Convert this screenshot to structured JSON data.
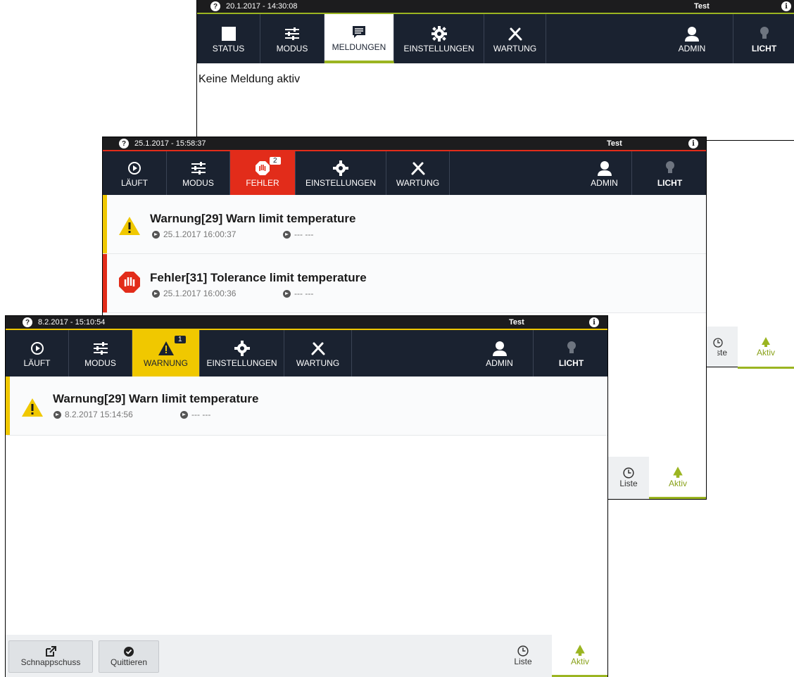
{
  "colors": {
    "nav_bg": "#1a2230",
    "accent_green": "#9bb521",
    "error_red": "#e22c1a",
    "warning_yellow": "#f0c800"
  },
  "panel1": {
    "datetime": "20.1.2017 - 14:30:08",
    "user": "Test",
    "tabs": {
      "status": "STATUS",
      "modus": "MODUS",
      "meldungen": "MELDUNGEN",
      "einstellungen": "EINSTELLUNGEN",
      "wartung": "WARTUNG",
      "admin": "ADMIN",
      "licht": "LICHT"
    },
    "message": "Keine Meldung aktiv"
  },
  "panel2": {
    "datetime": "25.1.2017 - 15:58:37",
    "user": "Test",
    "tabs": {
      "laeuft": "LÄUFT",
      "modus": "MODUS",
      "fehler": "FEHLER",
      "fehler_count": "2",
      "einstellungen": "EINSTELLUNGEN",
      "wartung": "WARTUNG",
      "admin": "ADMIN",
      "licht": "LICHT"
    },
    "messages": [
      {
        "title": "Warnung[29] Warn limit temperature",
        "start": "25.1.2017 16:00:37",
        "end": "--- ---",
        "icon": "warning-icon"
      },
      {
        "title": "Fehler[31] Tolerance limit temperature",
        "start": "25.1.2017 16:00:36",
        "end": "--- ---",
        "icon": "stop-hand-icon"
      }
    ],
    "footer": {
      "liste": "Liste",
      "aktiv": "Aktiv"
    }
  },
  "panel3": {
    "datetime": "8.2.2017 - 15:10:54",
    "user": "Test",
    "tabs": {
      "laeuft": "LÄUFT",
      "modus": "MODUS",
      "warnung": "WARNUNG",
      "warnung_count": "1",
      "einstellungen": "EINSTELLUNGEN",
      "wartung": "WARTUNG",
      "admin": "ADMIN",
      "licht": "LICHT"
    },
    "messages": [
      {
        "title": "Warnung[29] Warn limit temperature",
        "start": "8.2.2017 15:14:56",
        "end": "--- ---",
        "icon": "warning-icon"
      }
    ],
    "footer": {
      "schnappschuss": "Schnappschuss",
      "quittieren": "Quittieren",
      "liste": "Liste",
      "aktiv": "Aktiv"
    }
  },
  "panel1_footer": {
    "liste": "Liste",
    "aktiv": "Aktiv"
  }
}
